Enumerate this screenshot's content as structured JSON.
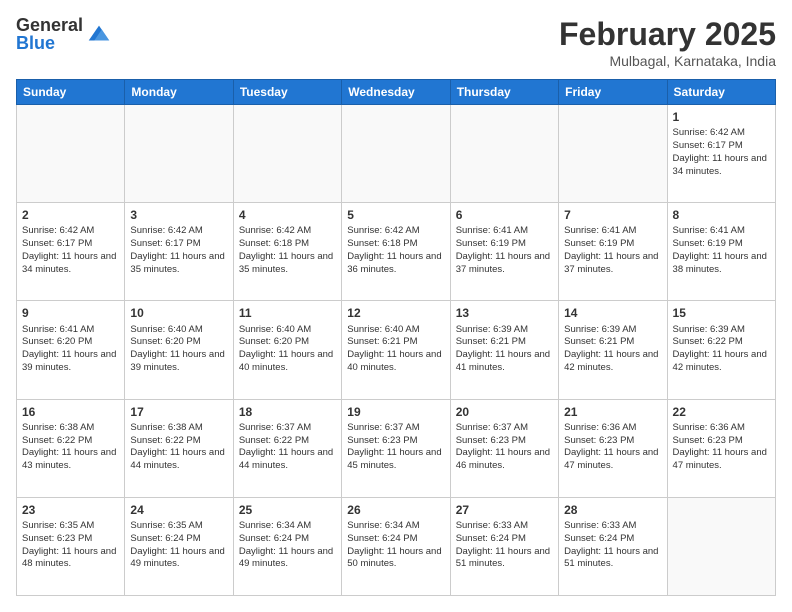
{
  "logo": {
    "general": "General",
    "blue": "Blue"
  },
  "title": {
    "month": "February 2025",
    "location": "Mulbagal, Karnataka, India"
  },
  "weekdays": [
    "Sunday",
    "Monday",
    "Tuesday",
    "Wednesday",
    "Thursday",
    "Friday",
    "Saturday"
  ],
  "weeks": [
    [
      {
        "day": "",
        "sunrise": "",
        "sunset": "",
        "daylight": "",
        "empty": true
      },
      {
        "day": "",
        "sunrise": "",
        "sunset": "",
        "daylight": "",
        "empty": true
      },
      {
        "day": "",
        "sunrise": "",
        "sunset": "",
        "daylight": "",
        "empty": true
      },
      {
        "day": "",
        "sunrise": "",
        "sunset": "",
        "daylight": "",
        "empty": true
      },
      {
        "day": "",
        "sunrise": "",
        "sunset": "",
        "daylight": "",
        "empty": true
      },
      {
        "day": "",
        "sunrise": "",
        "sunset": "",
        "daylight": "",
        "empty": true
      },
      {
        "day": "1",
        "sunrise": "Sunrise: 6:42 AM",
        "sunset": "Sunset: 6:17 PM",
        "daylight": "Daylight: 11 hours and 34 minutes.",
        "empty": false
      }
    ],
    [
      {
        "day": "2",
        "sunrise": "Sunrise: 6:42 AM",
        "sunset": "Sunset: 6:17 PM",
        "daylight": "Daylight: 11 hours and 34 minutes.",
        "empty": false
      },
      {
        "day": "3",
        "sunrise": "Sunrise: 6:42 AM",
        "sunset": "Sunset: 6:17 PM",
        "daylight": "Daylight: 11 hours and 35 minutes.",
        "empty": false
      },
      {
        "day": "4",
        "sunrise": "Sunrise: 6:42 AM",
        "sunset": "Sunset: 6:18 PM",
        "daylight": "Daylight: 11 hours and 35 minutes.",
        "empty": false
      },
      {
        "day": "5",
        "sunrise": "Sunrise: 6:42 AM",
        "sunset": "Sunset: 6:18 PM",
        "daylight": "Daylight: 11 hours and 36 minutes.",
        "empty": false
      },
      {
        "day": "6",
        "sunrise": "Sunrise: 6:41 AM",
        "sunset": "Sunset: 6:19 PM",
        "daylight": "Daylight: 11 hours and 37 minutes.",
        "empty": false
      },
      {
        "day": "7",
        "sunrise": "Sunrise: 6:41 AM",
        "sunset": "Sunset: 6:19 PM",
        "daylight": "Daylight: 11 hours and 37 minutes.",
        "empty": false
      },
      {
        "day": "8",
        "sunrise": "Sunrise: 6:41 AM",
        "sunset": "Sunset: 6:19 PM",
        "daylight": "Daylight: 11 hours and 38 minutes.",
        "empty": false
      }
    ],
    [
      {
        "day": "9",
        "sunrise": "Sunrise: 6:41 AM",
        "sunset": "Sunset: 6:20 PM",
        "daylight": "Daylight: 11 hours and 39 minutes.",
        "empty": false
      },
      {
        "day": "10",
        "sunrise": "Sunrise: 6:40 AM",
        "sunset": "Sunset: 6:20 PM",
        "daylight": "Daylight: 11 hours and 39 minutes.",
        "empty": false
      },
      {
        "day": "11",
        "sunrise": "Sunrise: 6:40 AM",
        "sunset": "Sunset: 6:20 PM",
        "daylight": "Daylight: 11 hours and 40 minutes.",
        "empty": false
      },
      {
        "day": "12",
        "sunrise": "Sunrise: 6:40 AM",
        "sunset": "Sunset: 6:21 PM",
        "daylight": "Daylight: 11 hours and 40 minutes.",
        "empty": false
      },
      {
        "day": "13",
        "sunrise": "Sunrise: 6:39 AM",
        "sunset": "Sunset: 6:21 PM",
        "daylight": "Daylight: 11 hours and 41 minutes.",
        "empty": false
      },
      {
        "day": "14",
        "sunrise": "Sunrise: 6:39 AM",
        "sunset": "Sunset: 6:21 PM",
        "daylight": "Daylight: 11 hours and 42 minutes.",
        "empty": false
      },
      {
        "day": "15",
        "sunrise": "Sunrise: 6:39 AM",
        "sunset": "Sunset: 6:22 PM",
        "daylight": "Daylight: 11 hours and 42 minutes.",
        "empty": false
      }
    ],
    [
      {
        "day": "16",
        "sunrise": "Sunrise: 6:38 AM",
        "sunset": "Sunset: 6:22 PM",
        "daylight": "Daylight: 11 hours and 43 minutes.",
        "empty": false
      },
      {
        "day": "17",
        "sunrise": "Sunrise: 6:38 AM",
        "sunset": "Sunset: 6:22 PM",
        "daylight": "Daylight: 11 hours and 44 minutes.",
        "empty": false
      },
      {
        "day": "18",
        "sunrise": "Sunrise: 6:37 AM",
        "sunset": "Sunset: 6:22 PM",
        "daylight": "Daylight: 11 hours and 44 minutes.",
        "empty": false
      },
      {
        "day": "19",
        "sunrise": "Sunrise: 6:37 AM",
        "sunset": "Sunset: 6:23 PM",
        "daylight": "Daylight: 11 hours and 45 minutes.",
        "empty": false
      },
      {
        "day": "20",
        "sunrise": "Sunrise: 6:37 AM",
        "sunset": "Sunset: 6:23 PM",
        "daylight": "Daylight: 11 hours and 46 minutes.",
        "empty": false
      },
      {
        "day": "21",
        "sunrise": "Sunrise: 6:36 AM",
        "sunset": "Sunset: 6:23 PM",
        "daylight": "Daylight: 11 hours and 47 minutes.",
        "empty": false
      },
      {
        "day": "22",
        "sunrise": "Sunrise: 6:36 AM",
        "sunset": "Sunset: 6:23 PM",
        "daylight": "Daylight: 11 hours and 47 minutes.",
        "empty": false
      }
    ],
    [
      {
        "day": "23",
        "sunrise": "Sunrise: 6:35 AM",
        "sunset": "Sunset: 6:23 PM",
        "daylight": "Daylight: 11 hours and 48 minutes.",
        "empty": false
      },
      {
        "day": "24",
        "sunrise": "Sunrise: 6:35 AM",
        "sunset": "Sunset: 6:24 PM",
        "daylight": "Daylight: 11 hours and 49 minutes.",
        "empty": false
      },
      {
        "day": "25",
        "sunrise": "Sunrise: 6:34 AM",
        "sunset": "Sunset: 6:24 PM",
        "daylight": "Daylight: 11 hours and 49 minutes.",
        "empty": false
      },
      {
        "day": "26",
        "sunrise": "Sunrise: 6:34 AM",
        "sunset": "Sunset: 6:24 PM",
        "daylight": "Daylight: 11 hours and 50 minutes.",
        "empty": false
      },
      {
        "day": "27",
        "sunrise": "Sunrise: 6:33 AM",
        "sunset": "Sunset: 6:24 PM",
        "daylight": "Daylight: 11 hours and 51 minutes.",
        "empty": false
      },
      {
        "day": "28",
        "sunrise": "Sunrise: 6:33 AM",
        "sunset": "Sunset: 6:24 PM",
        "daylight": "Daylight: 11 hours and 51 minutes.",
        "empty": false
      },
      {
        "day": "",
        "sunrise": "",
        "sunset": "",
        "daylight": "",
        "empty": true
      }
    ]
  ]
}
